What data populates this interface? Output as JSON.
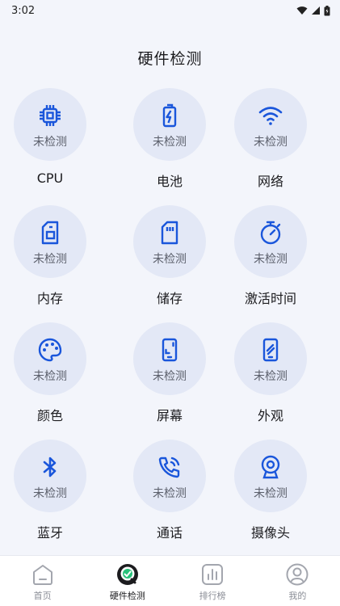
{
  "status_bar": {
    "time": "3:02"
  },
  "page": {
    "title": "硬件检测"
  },
  "accent_color": "#1a56db",
  "items": [
    {
      "label": "CPU",
      "status": "未检测",
      "icon": "cpu-icon"
    },
    {
      "label": "电池",
      "status": "未检测",
      "icon": "battery-icon"
    },
    {
      "label": "网络",
      "status": "未检测",
      "icon": "wifi-icon"
    },
    {
      "label": "内存",
      "status": "未检测",
      "icon": "sd-card-icon"
    },
    {
      "label": "储存",
      "status": "未检测",
      "icon": "storage-icon"
    },
    {
      "label": "激活时间",
      "status": "未检测",
      "icon": "timer-icon"
    },
    {
      "label": "颜色",
      "status": "未检测",
      "icon": "palette-icon"
    },
    {
      "label": "屏幕",
      "status": "未检测",
      "icon": "screen-icon"
    },
    {
      "label": "外观",
      "status": "未检测",
      "icon": "phone-appearance-icon"
    },
    {
      "label": "蓝牙",
      "status": "未检测",
      "icon": "bluetooth-icon"
    },
    {
      "label": "通话",
      "status": "未检测",
      "icon": "phone-call-icon"
    },
    {
      "label": "摄像头",
      "status": "未检测",
      "icon": "camera-icon"
    }
  ],
  "bottom_nav": [
    {
      "label": "首页",
      "icon": "home-icon",
      "active": false
    },
    {
      "label": "硬件检测",
      "icon": "hardware-check-icon",
      "active": true
    },
    {
      "label": "排行榜",
      "icon": "ranking-icon",
      "active": false
    },
    {
      "label": "我的",
      "icon": "profile-icon",
      "active": false
    }
  ]
}
